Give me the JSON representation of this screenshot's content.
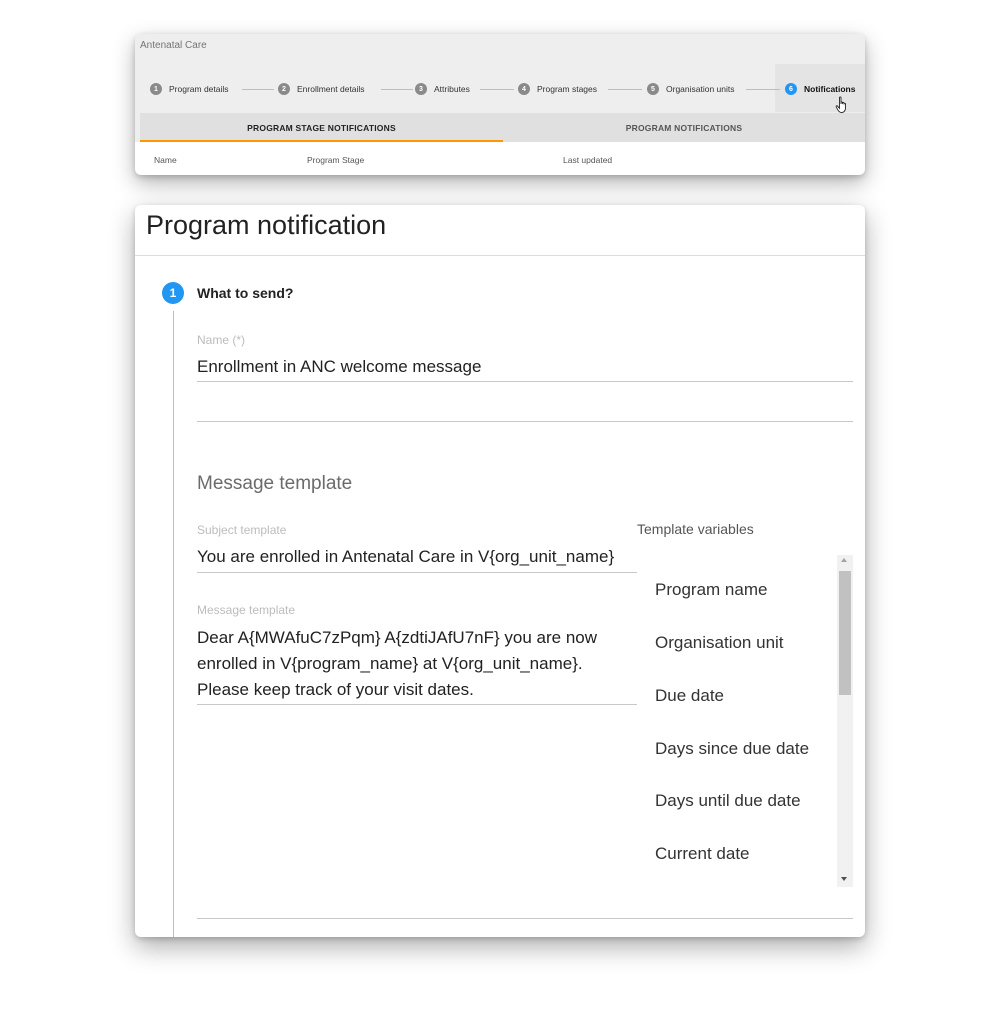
{
  "top_card": {
    "app_title": "Antenatal Care",
    "steps": [
      {
        "number": "1",
        "label": "Program details"
      },
      {
        "number": "2",
        "label": "Enrollment details"
      },
      {
        "number": "3",
        "label": "Attributes"
      },
      {
        "number": "4",
        "label": "Program stages"
      },
      {
        "number": "5",
        "label": "Organisation units"
      },
      {
        "number": "6",
        "label": "Notifications"
      }
    ],
    "active_step": "Notifications",
    "tabs": [
      {
        "label": "PROGRAM STAGE NOTIFICATIONS",
        "active": true
      },
      {
        "label": "PROGRAM NOTIFICATIONS",
        "active": false
      }
    ],
    "columns": [
      "Name",
      "Program Stage",
      "Last updated"
    ]
  },
  "dialog": {
    "title": "Program notification",
    "step": {
      "number": "1",
      "title": "What to send?"
    },
    "name_label": "Name (*)",
    "name_value": "Enrollment in ANC welcome message",
    "section_heading": "Message template",
    "subject_label": "Subject template",
    "subject_value": "You are enrolled in Antenatal Care in V{org_unit_name}",
    "message_label": "Message template",
    "message_lines": [
      "Dear A{MWAfuC7zPqm} A{zdtiJAfU7nF} you are now",
      "enrolled in V{program_name} at V{org_unit_name}.",
      "Please keep track of your visit dates."
    ],
    "variables_label": "Template variables",
    "variables": [
      "Program name",
      "Organisation unit",
      "Due date",
      "Days since due date",
      "Days until due date",
      "Current date"
    ]
  },
  "colors": {
    "accent": "#2196f3",
    "tab_indicator": "#ff9800",
    "inactive_step": "#8a8a8a"
  }
}
